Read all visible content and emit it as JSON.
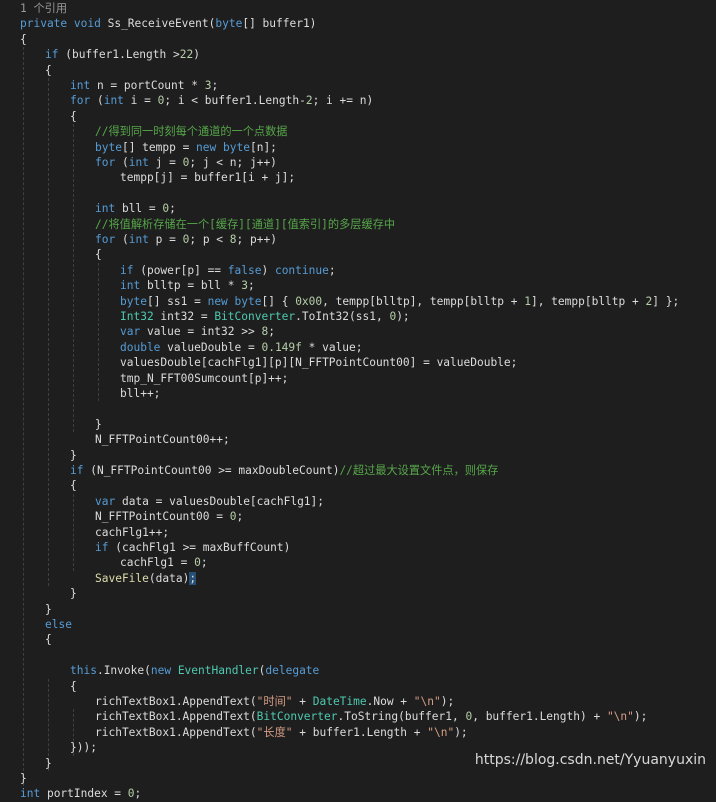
{
  "editor": {
    "lines": [
      {
        "indent": 0,
        "tokens": [
          {
            "t": "1 个引用",
            "c": "ref"
          }
        ]
      },
      {
        "indent": 0,
        "tokens": [
          {
            "t": "private",
            "c": "k"
          },
          {
            "t": " "
          },
          {
            "t": "void",
            "c": "k"
          },
          {
            "t": " Ss_ReceiveEvent("
          },
          {
            "t": "byte",
            "c": "k"
          },
          {
            "t": "[] buffer1)"
          }
        ]
      },
      {
        "indent": 0,
        "tokens": [
          {
            "t": "{"
          }
        ]
      },
      {
        "indent": 1,
        "tokens": [
          {
            "t": "if",
            "c": "k"
          },
          {
            "t": " (buffer1.Length >"
          },
          {
            "t": "22",
            "c": "n"
          },
          {
            "t": ")"
          }
        ]
      },
      {
        "indent": 1,
        "tokens": [
          {
            "t": "{"
          }
        ]
      },
      {
        "indent": 2,
        "tokens": [
          {
            "t": "int",
            "c": "k"
          },
          {
            "t": " n = portCount * "
          },
          {
            "t": "3",
            "c": "n"
          },
          {
            "t": ";"
          }
        ]
      },
      {
        "indent": 2,
        "tokens": [
          {
            "t": "for",
            "c": "k"
          },
          {
            "t": " ("
          },
          {
            "t": "int",
            "c": "k"
          },
          {
            "t": " i = "
          },
          {
            "t": "0",
            "c": "n"
          },
          {
            "t": "; i < buffer1.Length-"
          },
          {
            "t": "2",
            "c": "n"
          },
          {
            "t": "; i += n)"
          }
        ]
      },
      {
        "indent": 2,
        "tokens": [
          {
            "t": "{"
          }
        ]
      },
      {
        "indent": 3,
        "tokens": [
          {
            "t": "//得到同一时刻每个通道的一个点数据",
            "c": "c"
          }
        ]
      },
      {
        "indent": 3,
        "tokens": [
          {
            "t": "byte",
            "c": "k"
          },
          {
            "t": "[] tempp = "
          },
          {
            "t": "new",
            "c": "k"
          },
          {
            "t": " "
          },
          {
            "t": "byte",
            "c": "k"
          },
          {
            "t": "[n];"
          }
        ]
      },
      {
        "indent": 3,
        "tokens": [
          {
            "t": "for",
            "c": "k"
          },
          {
            "t": " ("
          },
          {
            "t": "int",
            "c": "k"
          },
          {
            "t": " j = "
          },
          {
            "t": "0",
            "c": "n"
          },
          {
            "t": "; j < n; j++)"
          }
        ]
      },
      {
        "indent": 4,
        "tokens": [
          {
            "t": "tempp[j] = buffer1[i + j];"
          }
        ]
      },
      {
        "indent": 0,
        "tokens": []
      },
      {
        "indent": 3,
        "tokens": [
          {
            "t": "int",
            "c": "k"
          },
          {
            "t": " bll = "
          },
          {
            "t": "0",
            "c": "n"
          },
          {
            "t": ";"
          }
        ]
      },
      {
        "indent": 3,
        "tokens": [
          {
            "t": "//将值解析存储在一个[缓存][通道][值索引]的多层缓存中",
            "c": "c"
          }
        ]
      },
      {
        "indent": 3,
        "tokens": [
          {
            "t": "for",
            "c": "k"
          },
          {
            "t": " ("
          },
          {
            "t": "int",
            "c": "k"
          },
          {
            "t": " p = "
          },
          {
            "t": "0",
            "c": "n"
          },
          {
            "t": "; p < "
          },
          {
            "t": "8",
            "c": "n"
          },
          {
            "t": "; p++)"
          }
        ]
      },
      {
        "indent": 3,
        "tokens": [
          {
            "t": "{"
          }
        ]
      },
      {
        "indent": 4,
        "tokens": [
          {
            "t": "if",
            "c": "k"
          },
          {
            "t": " (power[p] == "
          },
          {
            "t": "false",
            "c": "k"
          },
          {
            "t": ") "
          },
          {
            "t": "continue",
            "c": "k"
          },
          {
            "t": ";"
          }
        ]
      },
      {
        "indent": 4,
        "tokens": [
          {
            "t": "int",
            "c": "k"
          },
          {
            "t": " blltp = bll * "
          },
          {
            "t": "3",
            "c": "n"
          },
          {
            "t": ";"
          }
        ]
      },
      {
        "indent": 4,
        "tokens": [
          {
            "t": "byte",
            "c": "k"
          },
          {
            "t": "[] ss1 = "
          },
          {
            "t": "new",
            "c": "k"
          },
          {
            "t": " "
          },
          {
            "t": "byte",
            "c": "k"
          },
          {
            "t": "[] { "
          },
          {
            "t": "0x00",
            "c": "n"
          },
          {
            "t": ", tempp[blltp], tempp[blltp + "
          },
          {
            "t": "1",
            "c": "n"
          },
          {
            "t": "], tempp[blltp + "
          },
          {
            "t": "2",
            "c": "n"
          },
          {
            "t": "] };"
          }
        ]
      },
      {
        "indent": 4,
        "tokens": [
          {
            "t": "Int32",
            "c": "t"
          },
          {
            "t": " int32 = "
          },
          {
            "t": "BitConverter",
            "c": "t"
          },
          {
            "t": ".ToInt32(ss1, "
          },
          {
            "t": "0",
            "c": "n"
          },
          {
            "t": ");"
          }
        ]
      },
      {
        "indent": 4,
        "tokens": [
          {
            "t": "var",
            "c": "k"
          },
          {
            "t": " value = int32 >> "
          },
          {
            "t": "8",
            "c": "n"
          },
          {
            "t": ";"
          }
        ]
      },
      {
        "indent": 4,
        "tokens": [
          {
            "t": "double",
            "c": "k"
          },
          {
            "t": " valueDouble = "
          },
          {
            "t": "0.149f",
            "c": "n"
          },
          {
            "t": " * value;"
          }
        ]
      },
      {
        "indent": 4,
        "tokens": [
          {
            "t": "valuesDouble[cachFlg1][p][N_FFTPointCount00] = valueDouble;"
          }
        ]
      },
      {
        "indent": 4,
        "tokens": [
          {
            "t": "tmp_N_FFT00Sumcount[p]++;"
          }
        ]
      },
      {
        "indent": 4,
        "tokens": [
          {
            "t": "bll++;"
          }
        ]
      },
      {
        "indent": 0,
        "tokens": []
      },
      {
        "indent": 3,
        "tokens": [
          {
            "t": "}"
          }
        ]
      },
      {
        "indent": 3,
        "tokens": [
          {
            "t": "N_FFTPointCount00++;"
          }
        ]
      },
      {
        "indent": 2,
        "tokens": [
          {
            "t": "}"
          }
        ]
      },
      {
        "indent": 2,
        "tokens": [
          {
            "t": "if",
            "c": "k"
          },
          {
            "t": " (N_FFTPointCount00 >= maxDoubleCount)"
          },
          {
            "t": "//超过最大设置文件点，则保存",
            "c": "c"
          }
        ]
      },
      {
        "indent": 2,
        "tokens": [
          {
            "t": "{"
          }
        ]
      },
      {
        "indent": 3,
        "tokens": [
          {
            "t": "var",
            "c": "k"
          },
          {
            "t": " data = valuesDouble[cachFlg1];"
          }
        ]
      },
      {
        "indent": 3,
        "tokens": [
          {
            "t": "N_FFTPointCount00 = "
          },
          {
            "t": "0",
            "c": "n"
          },
          {
            "t": ";"
          }
        ]
      },
      {
        "indent": 3,
        "tokens": [
          {
            "t": "cachFlg1++;"
          }
        ]
      },
      {
        "indent": 3,
        "tokens": [
          {
            "t": "if",
            "c": "k"
          },
          {
            "t": " (cachFlg1 >= maxBuffCount)"
          }
        ]
      },
      {
        "indent": 4,
        "tokens": [
          {
            "t": "cachFlg1 = "
          },
          {
            "t": "0",
            "c": "n"
          },
          {
            "t": ";"
          }
        ]
      },
      {
        "indent": 3,
        "tokens": [
          {
            "t": "SaveFile",
            "c": "m"
          },
          {
            "t": "(data)"
          },
          {
            "t": ";",
            "c": "sel"
          }
        ]
      },
      {
        "indent": 2,
        "tokens": [
          {
            "t": "}"
          }
        ]
      },
      {
        "indent": 1,
        "tokens": [
          {
            "t": "}"
          }
        ]
      },
      {
        "indent": 1,
        "tokens": [
          {
            "t": "else",
            "c": "k"
          }
        ]
      },
      {
        "indent": 1,
        "tokens": [
          {
            "t": "{"
          }
        ]
      },
      {
        "indent": 0,
        "tokens": []
      },
      {
        "indent": 2,
        "tokens": [
          {
            "t": "this",
            "c": "k"
          },
          {
            "t": ".Invoke("
          },
          {
            "t": "new",
            "c": "k"
          },
          {
            "t": " "
          },
          {
            "t": "EventHandler",
            "c": "t"
          },
          {
            "t": "("
          },
          {
            "t": "delegate",
            "c": "k"
          }
        ]
      },
      {
        "indent": 2,
        "tokens": [
          {
            "t": "{"
          }
        ]
      },
      {
        "indent": 3,
        "tokens": [
          {
            "t": "richTextBox1.AppendText("
          },
          {
            "t": "\"时间\"",
            "c": "s"
          },
          {
            "t": " + "
          },
          {
            "t": "DateTime",
            "c": "t"
          },
          {
            "t": ".Now + "
          },
          {
            "t": "\"\\n\"",
            "c": "s"
          },
          {
            "t": ");"
          }
        ]
      },
      {
        "indent": 3,
        "tokens": [
          {
            "t": "richTextBox1.AppendText("
          },
          {
            "t": "BitConverter",
            "c": "t"
          },
          {
            "t": ".ToString(buffer1, "
          },
          {
            "t": "0",
            "c": "n"
          },
          {
            "t": ", buffer1.Length) + "
          },
          {
            "t": "\"\\n\"",
            "c": "s"
          },
          {
            "t": ");"
          }
        ]
      },
      {
        "indent": 3,
        "tokens": [
          {
            "t": "richTextBox1.AppendText("
          },
          {
            "t": "\"长度\"",
            "c": "s"
          },
          {
            "t": " + buffer1.Length + "
          },
          {
            "t": "\"\\n\"",
            "c": "s"
          },
          {
            "t": ");"
          }
        ]
      },
      {
        "indent": 2,
        "tokens": [
          {
            "t": "}));"
          }
        ]
      },
      {
        "indent": 1,
        "tokens": [
          {
            "t": "}"
          }
        ]
      },
      {
        "indent": 0,
        "tokens": [
          {
            "t": "}"
          }
        ]
      },
      {
        "indent": 0,
        "tokens": [
          {
            "t": "int",
            "c": "k"
          },
          {
            "t": " portIndex = "
          },
          {
            "t": "0",
            "c": "n"
          },
          {
            "t": ";"
          }
        ]
      }
    ]
  },
  "watermark": "https://blog.csdn.net/Yyuanyuxin"
}
